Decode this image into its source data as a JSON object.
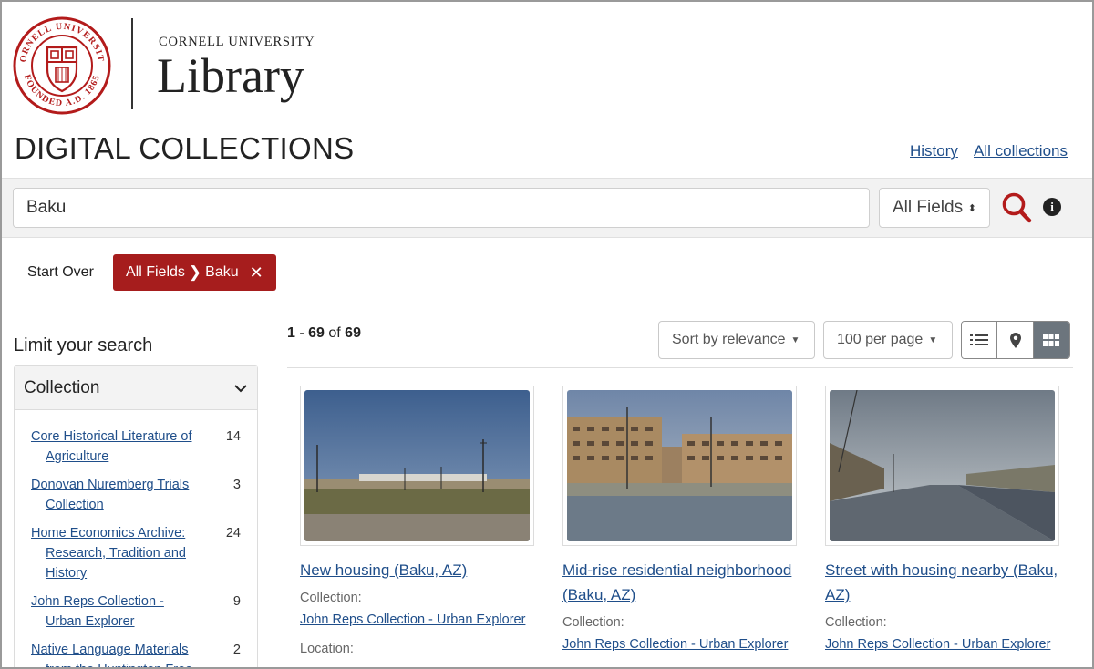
{
  "header": {
    "seal_text_top": "CORNELL UNIVERSITY",
    "seal_text_bottom": "FOUNDED A.D. 1865",
    "university": "CORNELL UNIVERSITY",
    "library": "Library",
    "site_title": "DIGITAL COLLECTIONS",
    "nav": {
      "history": "History",
      "all_collections": "All collections"
    }
  },
  "search": {
    "query": "Baku",
    "field": "All Fields"
  },
  "constraints": {
    "start_over": "Start Over",
    "active": {
      "field": "All Fields",
      "value": "Baku"
    }
  },
  "sidebar": {
    "title": "Limit your search",
    "facet": {
      "name": "Collection",
      "items": [
        {
          "label": "Core Historical Literature of Agriculture",
          "count": "14"
        },
        {
          "label": "Donovan Nuremberg Trials Collection",
          "count": "3"
        },
        {
          "label": "Home Economics Archive: Research, Tradition and History",
          "count": "24"
        },
        {
          "label": "John Reps Collection - Urban Explorer",
          "count": "9"
        },
        {
          "label": "Native Language Materials from the Huntington Free",
          "count": "2"
        }
      ]
    }
  },
  "results": {
    "range_start": "1",
    "range_end": "69",
    "of": "of",
    "total": "69",
    "sort": "Sort by relevance",
    "per_page": "100 per page",
    "views": [
      "list",
      "map",
      "gallery"
    ],
    "items": [
      {
        "title": "New housing (Baku, AZ)",
        "collection_label": "Collection:",
        "collection": "John Reps Collection - Urban Explorer",
        "location_label": "Location:"
      },
      {
        "title": "Mid-rise residential neighborhood (Baku, AZ)",
        "collection_label": "Collection:",
        "collection": "John Reps Collection - Urban Explorer"
      },
      {
        "title": "Street with housing nearby (Baku, AZ)",
        "collection_label": "Collection:",
        "collection": "John Reps Collection - Urban Explorer"
      }
    ]
  },
  "colors": {
    "brand_red": "#a61d1d",
    "link_blue": "#1f4e8a",
    "active_view": "#6c757d"
  }
}
